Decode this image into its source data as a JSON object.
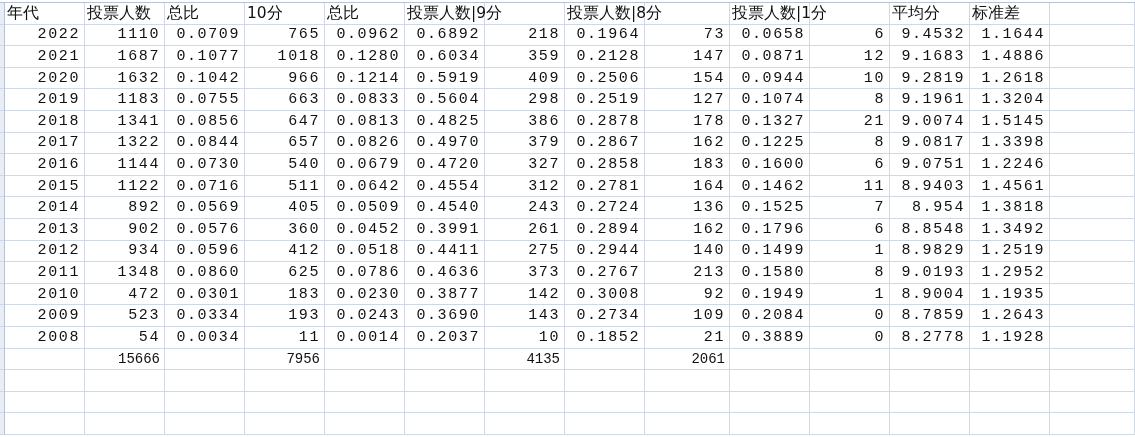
{
  "headers": {
    "A": "年代",
    "B": "投票人数",
    "C": "总比",
    "D": "10分",
    "E": "总比",
    "F": "投票人数|9分",
    "H": "投票人数|8分",
    "J": "投票人数|1分",
    "L": "平均分",
    "M": "标准差"
  },
  "rows": [
    [
      "2022",
      "1110",
      "0.0709",
      "765",
      "0.0962",
      "0.6892",
      "218",
      "0.1964",
      "73",
      "0.0658",
      "6",
      "9.4532",
      "1.1644"
    ],
    [
      "2021",
      "1687",
      "0.1077",
      "1018",
      "0.1280",
      "0.6034",
      "359",
      "0.2128",
      "147",
      "0.0871",
      "12",
      "9.1683",
      "1.4886"
    ],
    [
      "2020",
      "1632",
      "0.1042",
      "966",
      "0.1214",
      "0.5919",
      "409",
      "0.2506",
      "154",
      "0.0944",
      "10",
      "9.2819",
      "1.2618"
    ],
    [
      "2019",
      "1183",
      "0.0755",
      "663",
      "0.0833",
      "0.5604",
      "298",
      "0.2519",
      "127",
      "0.1074",
      "8",
      "9.1961",
      "1.3204"
    ],
    [
      "2018",
      "1341",
      "0.0856",
      "647",
      "0.0813",
      "0.4825",
      "386",
      "0.2878",
      "178",
      "0.1327",
      "21",
      "9.0074",
      "1.5145"
    ],
    [
      "2017",
      "1322",
      "0.0844",
      "657",
      "0.0826",
      "0.4970",
      "379",
      "0.2867",
      "162",
      "0.1225",
      "8",
      "9.0817",
      "1.3398"
    ],
    [
      "2016",
      "1144",
      "0.0730",
      "540",
      "0.0679",
      "0.4720",
      "327",
      "0.2858",
      "183",
      "0.1600",
      "6",
      "9.0751",
      "1.2246"
    ],
    [
      "2015",
      "1122",
      "0.0716",
      "511",
      "0.0642",
      "0.4554",
      "312",
      "0.2781",
      "164",
      "0.1462",
      "11",
      "8.9403",
      "1.4561"
    ],
    [
      "2014",
      "892",
      "0.0569",
      "405",
      "0.0509",
      "0.4540",
      "243",
      "0.2724",
      "136",
      "0.1525",
      "7",
      "8.954",
      "1.3818"
    ],
    [
      "2013",
      "902",
      "0.0576",
      "360",
      "0.0452",
      "0.3991",
      "261",
      "0.2894",
      "162",
      "0.1796",
      "6",
      "8.8548",
      "1.3492"
    ],
    [
      "2012",
      "934",
      "0.0596",
      "412",
      "0.0518",
      "0.4411",
      "275",
      "0.2944",
      "140",
      "0.1499",
      "1",
      "8.9829",
      "1.2519"
    ],
    [
      "2011",
      "1348",
      "0.0860",
      "625",
      "0.0786",
      "0.4636",
      "373",
      "0.2767",
      "213",
      "0.1580",
      "8",
      "9.0193",
      "1.2952"
    ],
    [
      "2010",
      "472",
      "0.0301",
      "183",
      "0.0230",
      "0.3877",
      "142",
      "0.3008",
      "92",
      "0.1949",
      "1",
      "8.9004",
      "1.1935"
    ],
    [
      "2009",
      "523",
      "0.0334",
      "193",
      "0.0243",
      "0.3690",
      "143",
      "0.2734",
      "109",
      "0.2084",
      "0",
      "8.7859",
      "1.2643"
    ],
    [
      "2008",
      "54",
      "0.0034",
      "11",
      "0.0014",
      "0.2037",
      "10",
      "0.1852",
      "21",
      "0.3889",
      "0",
      "8.2778",
      "1.1928"
    ]
  ],
  "totals": {
    "B": "15666",
    "D": "7956",
    "G": "4135",
    "I": "2061"
  }
}
